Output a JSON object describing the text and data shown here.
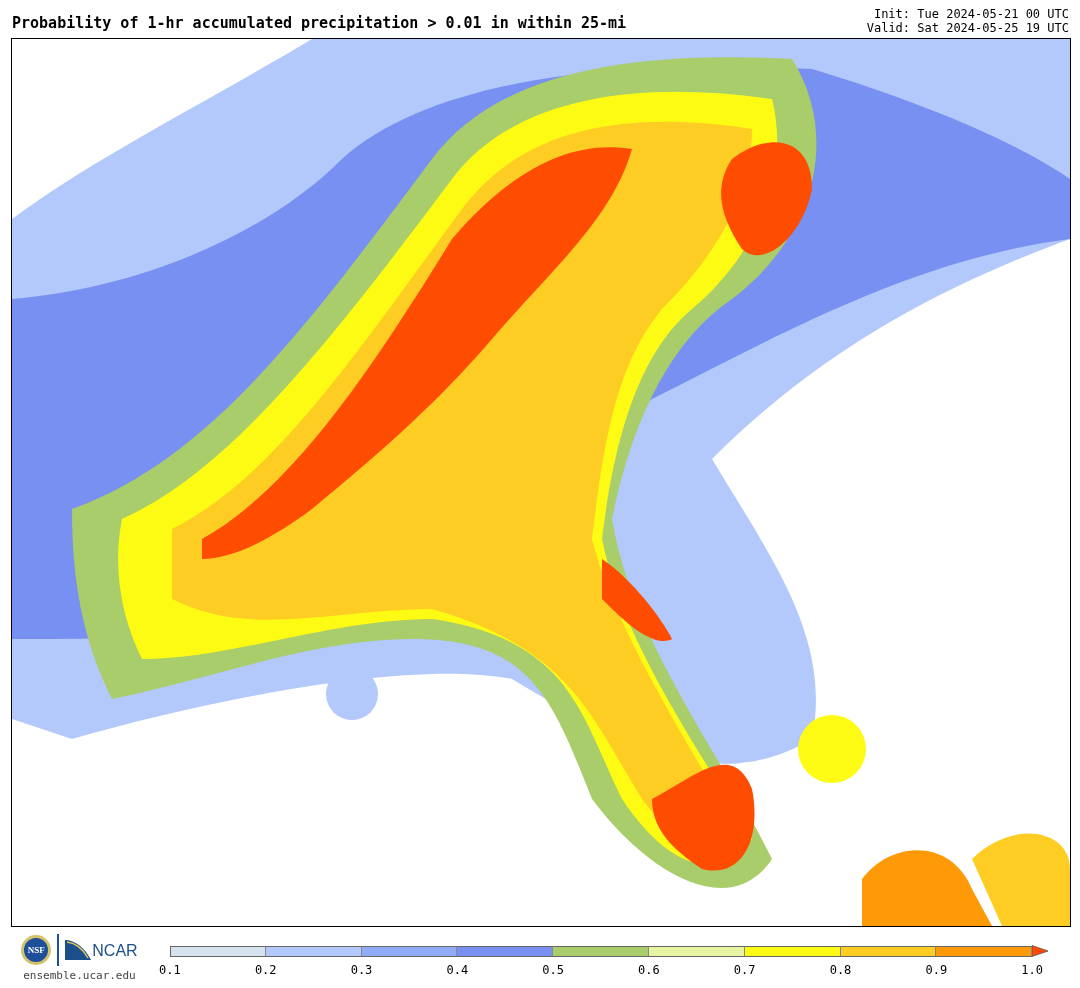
{
  "title": "Probability of 1-hr accumulated precipitation > 0.01 in within 25-mi",
  "init": "Init: Tue 2024-05-21 00 UTC",
  "valid": "Valid: Sat 2024-05-25 19 UTC",
  "logos": [
    {
      "kind": "nsf",
      "text": "NSF"
    },
    {
      "kind": "ncar",
      "text": "NCAR"
    }
  ],
  "url": "ensemble.ucar.edu",
  "colorbar": {
    "bins": [
      {
        "color": "#d6e2ee"
      },
      {
        "color": "#b3c8fb"
      },
      {
        "color": "#90acf7"
      },
      {
        "color": "#7890f2"
      },
      {
        "color": "#a8cd6a"
      },
      {
        "color": "#e6f4a4"
      },
      {
        "color": "#fdfb14"
      },
      {
        "color": "#fecd24"
      },
      {
        "color": "#fe9a08"
      },
      {
        "kind": "arrow",
        "color": "#ff4800"
      }
    ],
    "ticks": [
      "0.1",
      "0.2",
      "0.3",
      "0.4",
      "0.5",
      "0.6",
      "0.7",
      "0.8",
      "0.9",
      "1.0"
    ]
  }
}
